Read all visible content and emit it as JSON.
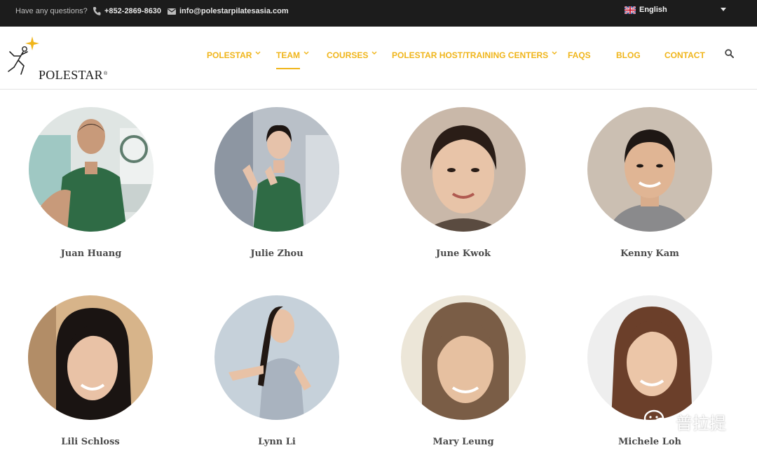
{
  "topbar": {
    "question": "Have any questions?",
    "phone": "+852-2869-8630",
    "email": "info@polestarpilatesasia.com",
    "language": "English",
    "icons": [
      "phone-icon",
      "mail-icon",
      "uk-flag-icon",
      "caret-down-icon"
    ]
  },
  "header": {
    "logo_text": "POLESTAR",
    "logo_mark": "®",
    "nav": [
      {
        "label": "POLESTAR",
        "has_dropdown": true
      },
      {
        "label": "TEAM",
        "has_dropdown": true,
        "active": true
      },
      {
        "label": "COURSES",
        "has_dropdown": true
      },
      {
        "label": "POLESTAR HOST/TRAINING CENTERS",
        "has_dropdown": true
      },
      {
        "label": "FAQS",
        "has_dropdown": false
      },
      {
        "label": "BLOG",
        "has_dropdown": false
      },
      {
        "label": "CONTACT",
        "has_dropdown": false
      }
    ],
    "search_icon": "search-icon"
  },
  "team": {
    "members": [
      {
        "name": "Juan Huang"
      },
      {
        "name": "Julie Zhou"
      },
      {
        "name": "June Kwok"
      },
      {
        "name": "Kenny Kam"
      },
      {
        "name": "Lili Schloss"
      },
      {
        "name": "Lynn Li"
      },
      {
        "name": "Mary Leung"
      },
      {
        "name": "Michele Loh"
      }
    ]
  },
  "watermark": {
    "text": "普拉提",
    "icon": "wechat-icon"
  },
  "colors": {
    "topbar_bg": "#1c1c1c",
    "accent": "#f0b51a",
    "name_text": "#4a4a4a"
  }
}
